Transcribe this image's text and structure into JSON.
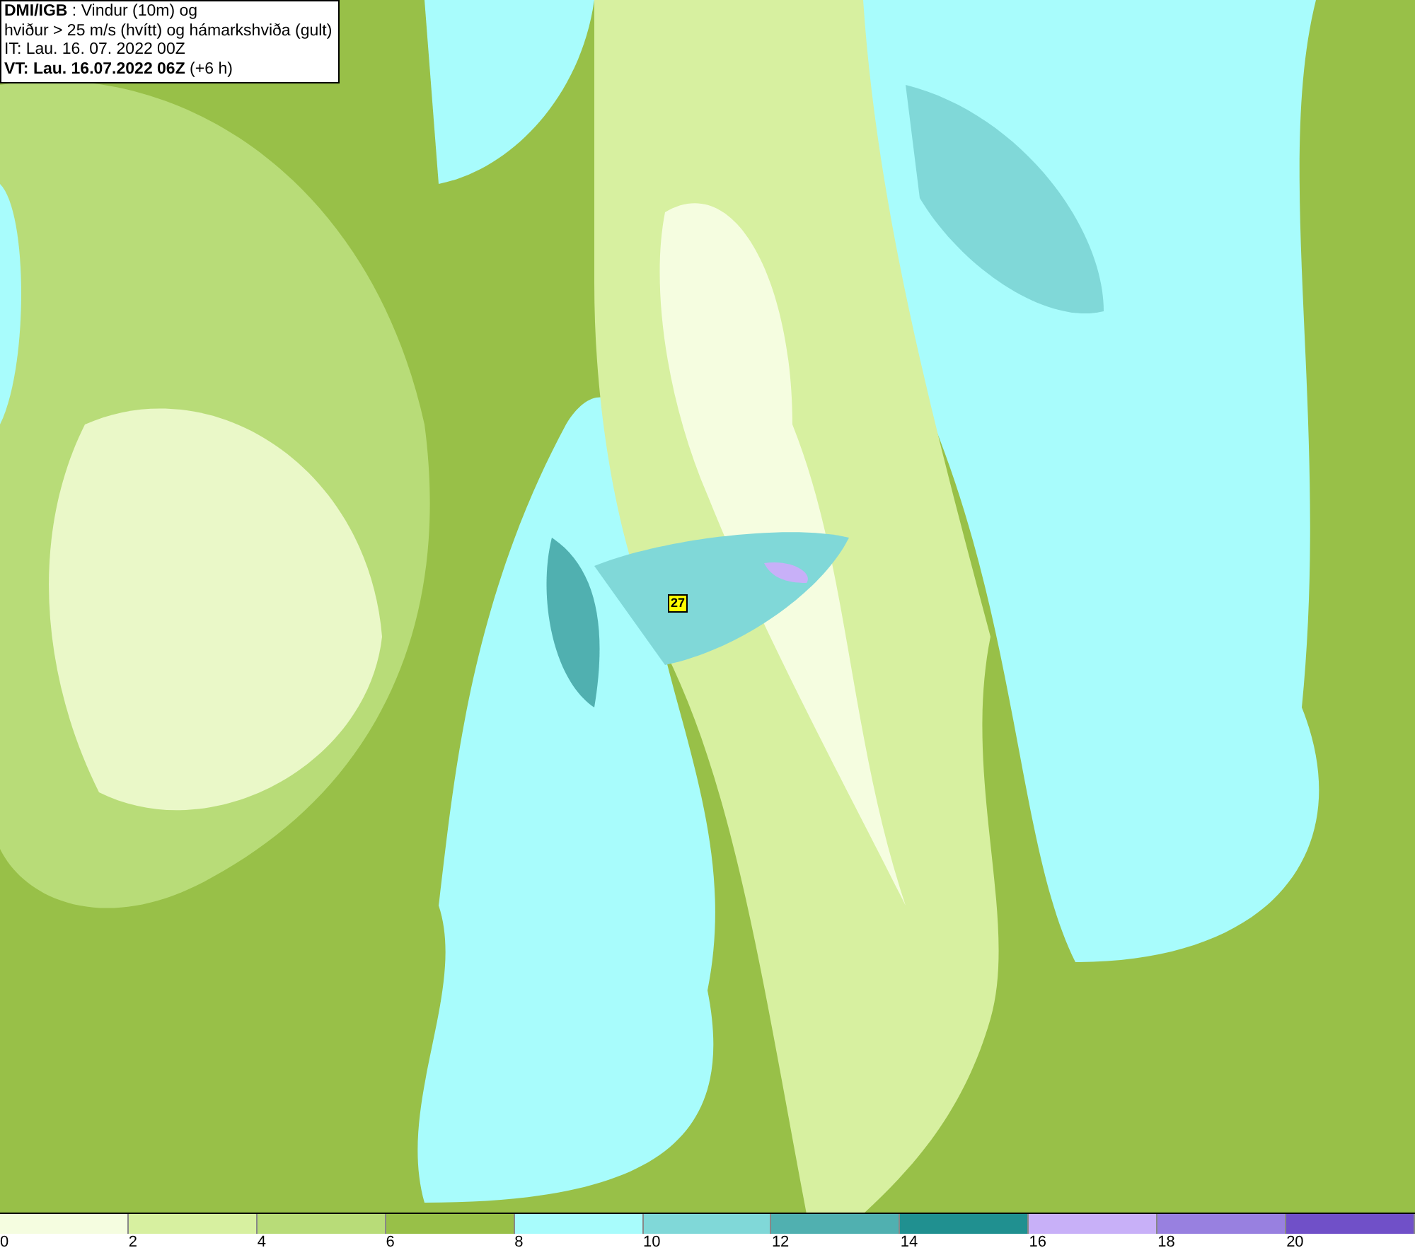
{
  "title_box": {
    "lines": [
      "**DMI/IGB** : Vindur (10m) og",
      "hviður > 25 m/s (hvítt) og hámarkshviða (gult)",
      "IT: Lau. 16. 07. 2022 00Z",
      "**VT: Lau. 16.07.2022 06Z** (+6 h)"
    ]
  },
  "map": {
    "gust_label": "27"
  },
  "legend": [
    {
      "label": "0",
      "color": "#f5fde0"
    },
    {
      "label": "2",
      "color": "#d7f0a0"
    },
    {
      "label": "4",
      "color": "#b8dc78"
    },
    {
      "label": "6",
      "color": "#98c048"
    },
    {
      "label": "8",
      "color": "#a8fcfc"
    },
    {
      "label": "10",
      "color": "#80d8d8"
    },
    {
      "label": "12",
      "color": "#50b0b0"
    },
    {
      "label": "14",
      "color": "#209090"
    },
    {
      "label": "16",
      "color": "#c8b0f8"
    },
    {
      "label": "18",
      "color": "#9880e0"
    },
    {
      "label": "20",
      "color": "#7050c8"
    }
  ]
}
